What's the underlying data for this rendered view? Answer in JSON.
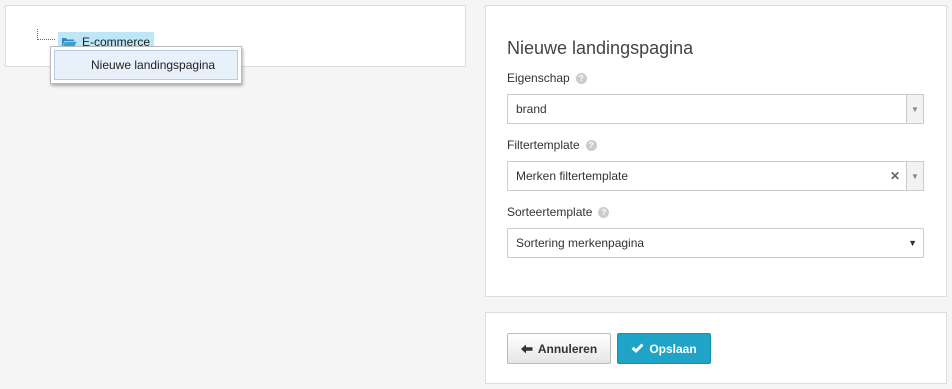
{
  "tree": {
    "node_label": "E-commerce",
    "node_icon": "folder-open-icon",
    "context_menu": {
      "item_label": "Nieuwe landingspagina"
    }
  },
  "form": {
    "title": "Nieuwe landingspagina",
    "fields": [
      {
        "label": "Eigenschap",
        "value": "brand"
      },
      {
        "label": "Filtertemplate",
        "value": "Merken filtertemplate"
      },
      {
        "label": "Sorteertemplate",
        "value": "Sortering merkenpagina"
      }
    ]
  },
  "actions": {
    "cancel_label": "Annuleren",
    "cancel_icon": "arrow-left-icon",
    "save_label": "Opslaan",
    "save_icon": "check-icon",
    "save_color": "#1fa3c6"
  }
}
